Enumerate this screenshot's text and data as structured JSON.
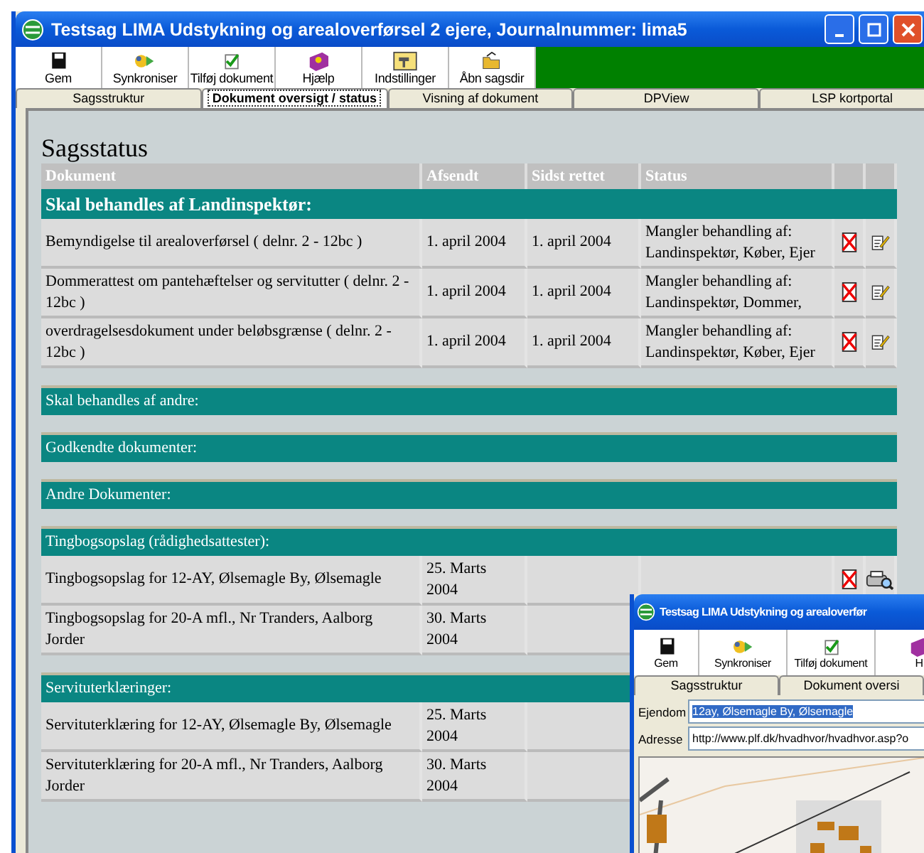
{
  "window": {
    "title": "Testsag LIMA Udstykning og arealoverførsel 2 ejere, Journalnummer: lima5"
  },
  "toolbar": [
    {
      "label": "Gem"
    },
    {
      "label": "Synkroniser"
    },
    {
      "label": "Tilføj dokument"
    },
    {
      "label": "Hjælp"
    },
    {
      "label": "Indstillinger"
    },
    {
      "label": "Åbn sagsdir"
    }
  ],
  "tabs": [
    {
      "label": "Sagsstruktur",
      "selected": false
    },
    {
      "label": "Dokument oversigt / status",
      "selected": true
    },
    {
      "label": "Visning af dokument",
      "selected": false
    },
    {
      "label": "DPView",
      "selected": false
    },
    {
      "label": "LSP kortportal",
      "selected": false
    }
  ],
  "content": {
    "heading": "Sagsstatus",
    "columns": [
      "Dokument",
      "Afsendt",
      "Sidst rettet",
      "Status"
    ],
    "sections": [
      {
        "title": "Skal behandles af Landinspektør:",
        "bold": true,
        "rows": [
          {
            "document": "Bemyndigelse til arealoverførsel ( delnr. 2 - 12bc )",
            "sent": "1. april 2004",
            "edited": "1. april 2004",
            "status": "Mangler behandling af: Landinspektør, Køber, Ejer",
            "actions": [
              {
                "kind": "delete"
              },
              {
                "kind": "edit"
              }
            ]
          },
          {
            "document": "Dommerattest om pantehæftelser og servitutter ( delnr. 2 - 12bc )",
            "sent": "1. april 2004",
            "edited": "1. april 2004",
            "status": "Mangler behandling af: Landinspektør, Dommer,",
            "actions": [
              {
                "kind": "delete"
              },
              {
                "kind": "edit"
              }
            ]
          },
          {
            "document": "overdragelsesdokument under beløbsgrænse ( delnr. 2 - 12bc )",
            "sent": "1. april 2004",
            "edited": "1. april 2004",
            "status": "Mangler behandling af: Landinspektør, Køber, Ejer",
            "actions": [
              {
                "kind": "delete"
              },
              {
                "kind": "edit"
              }
            ]
          }
        ]
      },
      {
        "title": "Skal behandles af andre:",
        "bold": false
      },
      {
        "title": "Godkendte dokumenter:",
        "bold": false
      },
      {
        "title": "Andre Dokumenter:",
        "bold": false
      },
      {
        "title": "Tingbogsopslag (rådighedsattester):",
        "bold": false,
        "rows": [
          {
            "document": "Tingbogsopslag for 12-AY, Ølsemagle By, Ølsemagle",
            "sent": "25. Marts 2004",
            "actions": [
              {
                "kind": "delete"
              },
              {
                "kind": "view"
              }
            ]
          },
          {
            "document": "Tingbogsopslag for 20-A mfl., Nr Tranders, Aalborg Jorder",
            "sent": "30. Marts 2004"
          }
        ]
      },
      {
        "title": "Servituterklæringer:",
        "bold": false,
        "rows": [
          {
            "document": "Servituterklæring for 12-AY, Ølsemagle By, Ølsemagle",
            "sent": "25. Marts 2004"
          },
          {
            "document": "Servituterklæring for 20-A mfl., Nr Tranders, Aalborg Jorder",
            "sent": "30. Marts 2004"
          }
        ]
      }
    ]
  },
  "second_window": {
    "title": "Testsag LIMA Udstykning og arealoverfør",
    "toolbar": [
      {
        "label": "Gem"
      },
      {
        "label": "Synkroniser"
      },
      {
        "label": "Tilføj dokument"
      },
      {
        "label": "H"
      }
    ],
    "tabs": [
      {
        "label": "Sagsstruktur",
        "selected": false
      },
      {
        "label": "Dokument oversi",
        "selected": false
      }
    ],
    "fields": [
      {
        "label": "Ejendom",
        "value": "12ay, Ølsemagle By, Ølsemagle",
        "highlighted": true
      },
      {
        "label": "Adresse",
        "value": "http://www.plf.dk/hvadhvor/hvadhvor.asp?o",
        "highlighted": false
      }
    ]
  }
}
